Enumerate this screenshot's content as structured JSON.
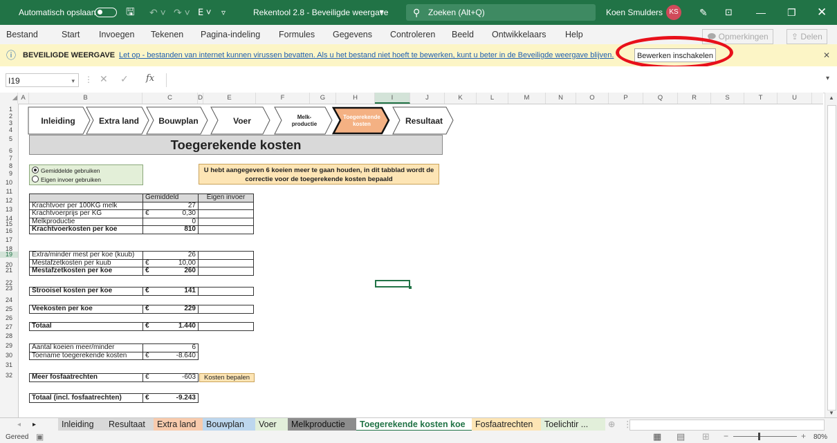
{
  "titlebar": {
    "autosave": "Automatisch opslaan",
    "doc_title": "Rekentool 2.8  -  Beveiligde weergave",
    "search_placeholder": "Zoeken (Alt+Q)",
    "user": "Koen Smulders",
    "initials": "KS"
  },
  "menu": {
    "items": [
      "Bestand",
      "Start",
      "Invoegen",
      "Tekenen",
      "Pagina-indeling",
      "Formules",
      "Gegevens",
      "Controleren",
      "Beeld",
      "Ontwikkelaars",
      "Help"
    ],
    "comments": "Opmerkingen",
    "share": "Delen"
  },
  "protected_view": {
    "title": "BEVEILIGDE WEERGAVE",
    "message": "Let op - bestanden van internet kunnen virussen bevatten. Als u het bestand niet hoeft te bewerken, kunt u beter in de Beveiligde weergave blijven.",
    "enable_button": "Bewerken inschakelen"
  },
  "formula_bar": {
    "name_box": "I19",
    "fx": "fx"
  },
  "columns": [
    "A",
    "B",
    "C",
    "D",
    "E",
    "F",
    "G",
    "H",
    "I",
    "J",
    "K",
    "L",
    "M",
    "N",
    "O",
    "P",
    "Q",
    "R",
    "S",
    "T",
    "U"
  ],
  "rows": [
    "1",
    "2",
    "3",
    "4",
    "5",
    "6",
    "7",
    "8",
    "9",
    "10",
    "11",
    "12",
    "13",
    "14",
    "15",
    "16",
    "17",
    "18",
    "19",
    "20",
    "21",
    "22",
    "23",
    "24",
    "25",
    "26",
    "27",
    "28",
    "29",
    "30",
    "31",
    "32"
  ],
  "nav": [
    {
      "label": "Inleiding"
    },
    {
      "label": "Extra land"
    },
    {
      "label": "Bouwplan"
    },
    {
      "label": "Voer"
    },
    {
      "label": "Melk-\nproductie"
    },
    {
      "label": "Toegerekende\nkosten"
    },
    {
      "label": "Resultaat"
    }
  ],
  "sheet_title": "Toegerekende kosten",
  "radio": {
    "option1": "Gemiddelde gebruiken",
    "option2": "Eigen invoer gebruiken"
  },
  "info": "U hebt aangegeven 6 koeien meer te gaan houden, in dit tabblad wordt de correctie voor de toegerekende kosten bepaald",
  "table": {
    "head_avg": "Gemiddeld",
    "head_own": "Eigen invoer",
    "b1": [
      {
        "label": "Krachtvoer per 100KG melk",
        "cur": "",
        "val": "27"
      },
      {
        "label": "Krachtvoerprijs per KG",
        "cur": "€",
        "val": "0,30"
      },
      {
        "label": "Melkproductie",
        "cur": "",
        "val": "0"
      },
      {
        "label": "Krachtvoerkosten per koe",
        "cur": "",
        "val": "810"
      }
    ],
    "b2": [
      {
        "label": "Extra/minder mest per koe (kuub)",
        "cur": "",
        "val": "26"
      },
      {
        "label": "Mestafzetkosten per kuub",
        "cur": "€",
        "val": "10,00"
      },
      {
        "label": "Mestafzetkosten per koe",
        "cur": "€",
        "val": "260"
      }
    ],
    "strooisel": {
      "label": "Strooisel kosten per koe",
      "cur": "€",
      "val": "141"
    },
    "vee": {
      "label": "Veekosten per koe",
      "cur": "€",
      "val": "229"
    },
    "totaal": {
      "label": "Totaal",
      "cur": "€",
      "val": "1.440"
    },
    "b3": [
      {
        "label": "Aantal koeien meer/minder",
        "cur": "",
        "val": "6"
      },
      {
        "label": "Toename toegerekende kosten",
        "cur": "€",
        "val": "-8.640"
      }
    ],
    "fosfaat": {
      "label": "Meer fosfaatrechten",
      "cur": "€",
      "val": "-603"
    },
    "totaal_incl": {
      "label": "Totaal (incl. fosfaatrechten)",
      "cur": "€",
      "val": "-9.243"
    }
  },
  "kosten_button": "Kosten bepalen",
  "tabs": [
    "Inleiding",
    "Resultaat",
    "Extra land",
    "Bouwplan",
    "Voer",
    "Melkproductie",
    "Toegerekende kosten koe",
    "Fosfaatrechten",
    "Toelichtir ..."
  ],
  "status": {
    "ready": "Gereed",
    "zoom": "80%"
  },
  "colors": {
    "excel_green": "#217346",
    "banner": "#fcf5c6",
    "highlight": "#f4b183",
    "annotation": "#e8101a"
  }
}
